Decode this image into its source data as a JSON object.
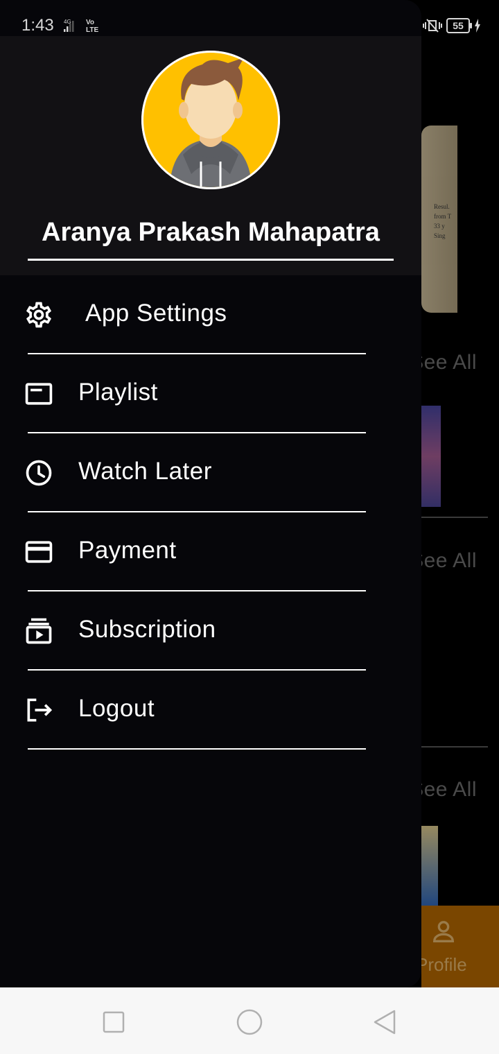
{
  "status_bar": {
    "time": "1:43",
    "network_4g": "4G",
    "volte": "Vo\nLTE",
    "battery": "55"
  },
  "drawer": {
    "user_name": "Aranya Prakash Mahapatra",
    "avatar_icon": "person-avatar-icon",
    "menu": [
      {
        "label": "App Settings",
        "icon": "gear-icon"
      },
      {
        "label": "Playlist",
        "icon": "playlist-icon"
      },
      {
        "label": "Watch Later",
        "icon": "clock-icon"
      },
      {
        "label": "Payment",
        "icon": "credit-card-icon"
      },
      {
        "label": "Subscription",
        "icon": "subscriptions-icon"
      },
      {
        "label": "Logout",
        "icon": "logout-icon"
      }
    ]
  },
  "background": {
    "see_all_1": "See All",
    "see_all_2": "See All",
    "see_all_3": "See All",
    "profile_label": "Profile"
  },
  "colors": {
    "drawer_bg": "#06060a",
    "header_bg": "#121114",
    "avatar_bg": "#ffc000",
    "bottom_nav_bg": "#7a4600"
  }
}
